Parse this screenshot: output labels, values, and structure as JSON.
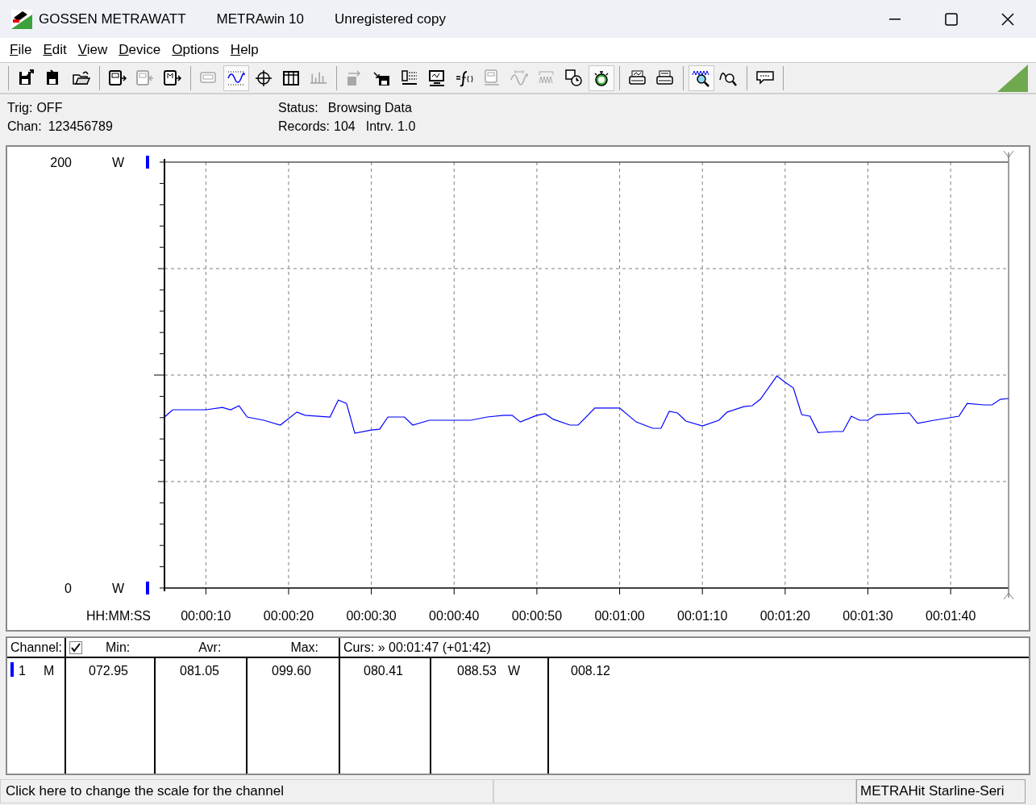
{
  "window": {
    "title_parts": [
      "GOSSEN METRAWATT",
      "METRAwin 10",
      "Unregistered copy"
    ]
  },
  "menu": [
    {
      "label": "File"
    },
    {
      "label": "Edit"
    },
    {
      "label": "View"
    },
    {
      "label": "Device"
    },
    {
      "label": "Options"
    },
    {
      "label": "Help"
    }
  ],
  "toolbar": [
    [
      {
        "kind": "save-out",
        "disabled": false,
        "selected": false
      },
      {
        "kind": "save-in",
        "disabled": false,
        "selected": false
      },
      {
        "kind": "open",
        "disabled": false,
        "selected": false
      }
    ],
    [
      {
        "kind": "meter-out",
        "disabled": false,
        "selected": false
      },
      {
        "kind": "meter-in",
        "disabled": true,
        "selected": false
      },
      {
        "kind": "meter-m",
        "disabled": false,
        "selected": false
      }
    ],
    [
      {
        "kind": "display",
        "disabled": true,
        "selected": false
      },
      {
        "kind": "wave",
        "disabled": false,
        "selected": true
      },
      {
        "kind": "crosshair",
        "disabled": false,
        "selected": false
      },
      {
        "kind": "table",
        "disabled": false,
        "selected": false
      },
      {
        "kind": "bars",
        "disabled": true,
        "selected": false
      }
    ],
    [
      {
        "kind": "transfer",
        "disabled": true,
        "selected": false
      },
      {
        "kind": "save-device",
        "disabled": false,
        "selected": false
      },
      {
        "kind": "grid-list",
        "disabled": false,
        "selected": false
      },
      {
        "kind": "monitor",
        "disabled": false,
        "selected": false
      },
      {
        "kind": "function",
        "disabled": false,
        "selected": false
      },
      {
        "kind": "meter-list",
        "disabled": true,
        "selected": false
      },
      {
        "kind": "sine-range",
        "disabled": true,
        "selected": false
      },
      {
        "kind": "wave-range",
        "disabled": true,
        "selected": false
      },
      {
        "kind": "clock",
        "disabled": false,
        "selected": false
      },
      {
        "kind": "stopwatch",
        "disabled": false,
        "selected": true
      }
    ],
    [
      {
        "kind": "printer-preview",
        "disabled": false,
        "selected": false
      },
      {
        "kind": "printer",
        "disabled": false,
        "selected": false
      }
    ],
    [
      {
        "kind": "zoom-wave",
        "disabled": false,
        "selected": true
      },
      {
        "kind": "zoom-sine",
        "disabled": false,
        "selected": false
      }
    ],
    [
      {
        "kind": "speech",
        "disabled": false,
        "selected": false
      }
    ]
  ],
  "info": {
    "trig": {
      "label": "Trig:",
      "value": "OFF"
    },
    "chan": {
      "label": "Chan:",
      "value": "123456789"
    },
    "status": {
      "label": "Status:",
      "value": "Browsing Data"
    },
    "records": {
      "label": "Records:",
      "value": "104"
    },
    "interval": {
      "label": "Intrv.",
      "value": "1.0"
    }
  },
  "chart": {
    "top_unit": "W",
    "bottom_unit": "W",
    "time_label": "HH:MM:SS",
    "chart_data": {
      "type": "line",
      "xlim": [
        5,
        107
      ],
      "ylim": [
        0,
        200
      ],
      "yticks": [
        {
          "value": 0,
          "label": "0"
        },
        {
          "value": 200,
          "label": "200"
        }
      ],
      "xticks": [
        {
          "value": 10,
          "label": "00:00:10"
        },
        {
          "value": 20,
          "label": "00:00:20"
        },
        {
          "value": 30,
          "label": "00:00:30"
        },
        {
          "value": 40,
          "label": "00:00:40"
        },
        {
          "value": 50,
          "label": "00:00:50"
        },
        {
          "value": 60,
          "label": "00:01:00"
        },
        {
          "value": 70,
          "label": "00:01:10"
        },
        {
          "value": 80,
          "label": "00:01:20"
        },
        {
          "value": 90,
          "label": "00:01:30"
        },
        {
          "value": 100,
          "label": "00:01:40"
        }
      ],
      "x": [
        5,
        6,
        10,
        12,
        13,
        14,
        15,
        17,
        19,
        21,
        22,
        25,
        26,
        27,
        28,
        30,
        31,
        32,
        34,
        35,
        37,
        39,
        42,
        44,
        46,
        47,
        48,
        50,
        51,
        52,
        54,
        55,
        57,
        60,
        62,
        64,
        65,
        66,
        67,
        68,
        70,
        72,
        73,
        75,
        76,
        77,
        79,
        80,
        81,
        82,
        83,
        84,
        86,
        87,
        88,
        89,
        90,
        91,
        95,
        96,
        98,
        101,
        102,
        104,
        105,
        106,
        107
      ],
      "grid": true,
      "ref_lines": [
        {
          "axis": "x",
          "value": 107
        }
      ],
      "series": [
        {
          "color": "#0000ff",
          "values": [
            80.3,
            83.7,
            83.7,
            84.8,
            83.7,
            85.6,
            80.3,
            78.8,
            76.5,
            82.6,
            81.1,
            80.3,
            88.3,
            86.7,
            72.7,
            74.2,
            74.6,
            80.3,
            80.3,
            76.5,
            78.8,
            78.8,
            78.8,
            80.3,
            81.1,
            81.1,
            78.0,
            81.1,
            81.8,
            79.2,
            76.5,
            76.5,
            84.5,
            84.5,
            78.0,
            75.0,
            75.0,
            83.0,
            82.2,
            78.4,
            76.1,
            78.8,
            82.6,
            85.2,
            85.6,
            88.6,
            99.6,
            96.6,
            93.9,
            81.4,
            80.7,
            73.0,
            73.5,
            73.5,
            80.7,
            78.8,
            78.8,
            81.4,
            82.2,
            77.3,
            78.8,
            80.7,
            86.7,
            86.0,
            86.0,
            88.6,
            89.0
          ]
        }
      ]
    }
  },
  "table": {
    "header": {
      "channel": "Channel:",
      "checked": true,
      "min": "Min:",
      "avr": "Avr:",
      "max": "Max:",
      "cursor": "Curs: » 00:01:47 (+01:42)"
    },
    "rows": [
      {
        "color": "#0000ff",
        "number": "1",
        "mode": "M",
        "min": "072.95",
        "avr": "081.05",
        "max": "099.60",
        "cursor_value": "080.41",
        "column_6": "088.53",
        "unit": "W",
        "column_7": "008.12"
      }
    ]
  },
  "status_bar": {
    "hint": "Click here to change the scale for the channel",
    "device": "METRAHit Starline-Seri"
  }
}
